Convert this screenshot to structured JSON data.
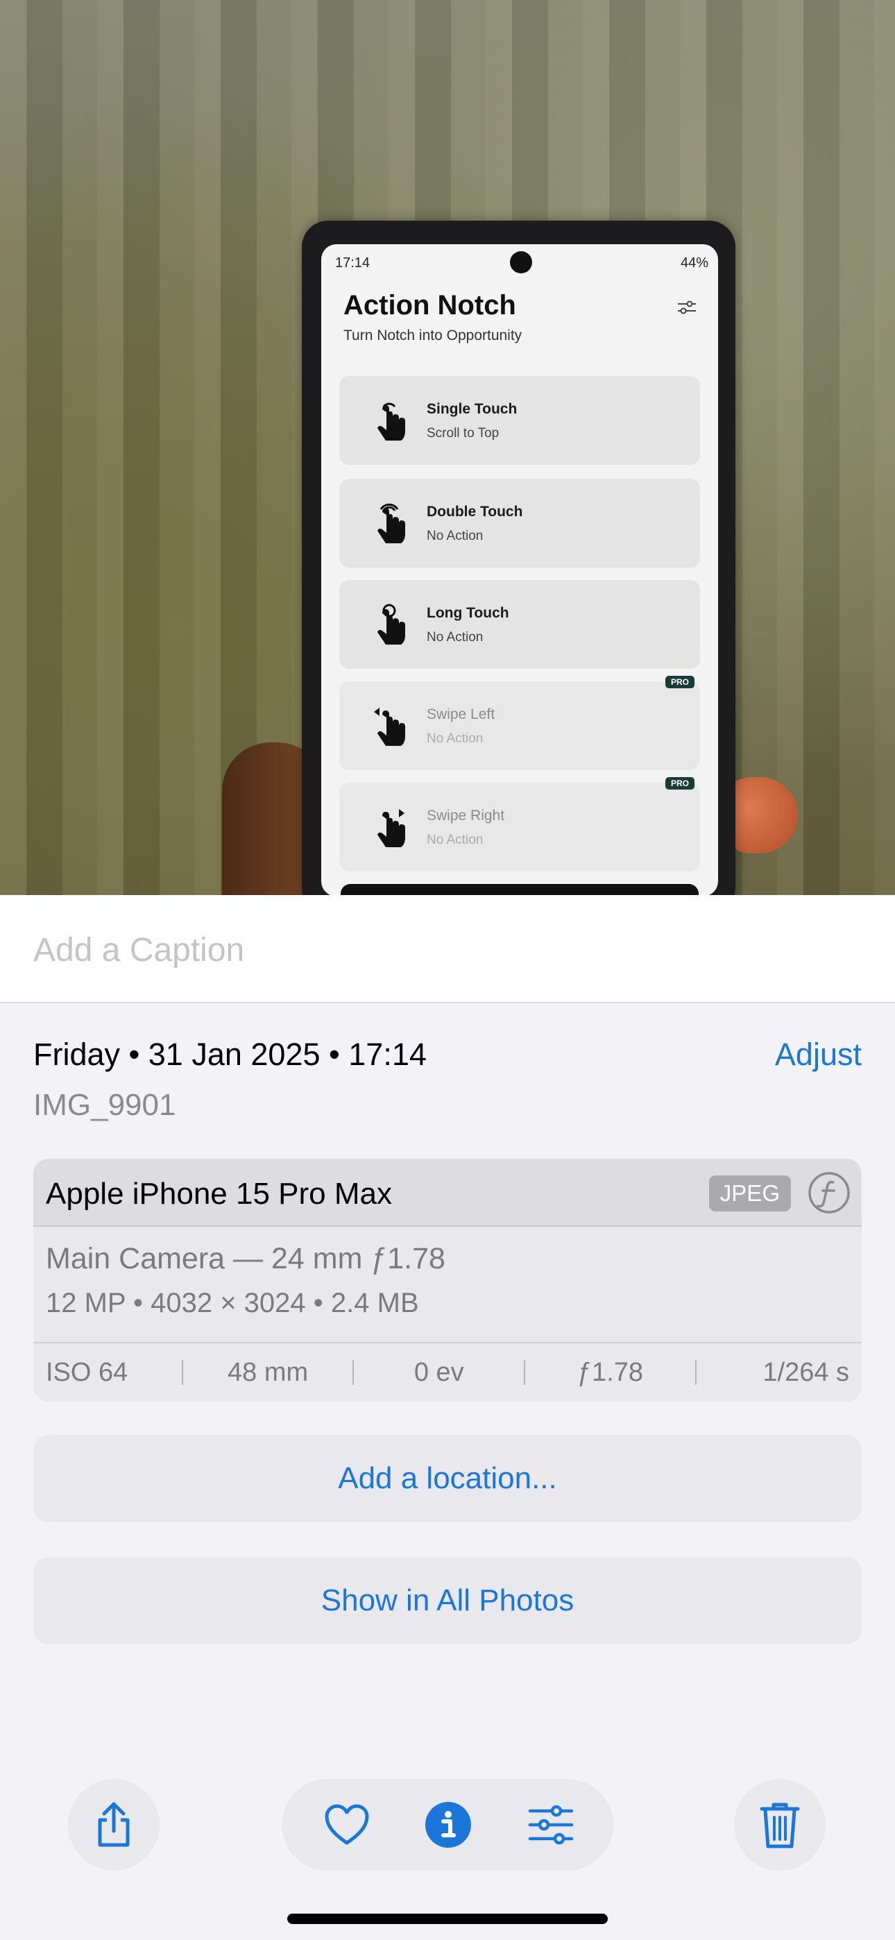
{
  "photo": {
    "status_time": "17:14",
    "status_battery": "44%",
    "app_title": "Action Notch",
    "app_subtitle": "Turn Notch into Opportunity",
    "cards": [
      {
        "name": "Single Touch",
        "action": "Scroll to Top",
        "pro": ""
      },
      {
        "name": "Double Touch",
        "action": "No Action",
        "pro": ""
      },
      {
        "name": "Long Touch",
        "action": "No Action",
        "pro": ""
      },
      {
        "name": "Swipe Left",
        "action": "No Action",
        "pro": "PRO"
      },
      {
        "name": "Swipe Right",
        "action": "No Action",
        "pro": "PRO"
      }
    ]
  },
  "caption": {
    "placeholder": "Add a Caption",
    "value": ""
  },
  "info": {
    "datetime": "Friday • 31 Jan 2025 • 17:14",
    "adjust_label": "Adjust",
    "filename": "IMG_9901"
  },
  "exif": {
    "device": "Apple iPhone 15 Pro Max",
    "format": "JPEG",
    "lens": "Main Camera — 24 mm ƒ1.78",
    "specs": "12 MP • 4032 × 3024 • 2.4 MB",
    "iso": "ISO 64",
    "focal_length": "48 mm",
    "exposure_value": "0 ev",
    "aperture": "ƒ1.78",
    "shutter": "1/264 s"
  },
  "actions": {
    "add_location": "Add a location...",
    "show_all": "Show in All Photos"
  },
  "toolbar": {
    "icons": [
      "share-icon",
      "heart-icon",
      "info-icon",
      "sliders-icon",
      "trash-icon"
    ],
    "accent": "#1b76d9"
  }
}
